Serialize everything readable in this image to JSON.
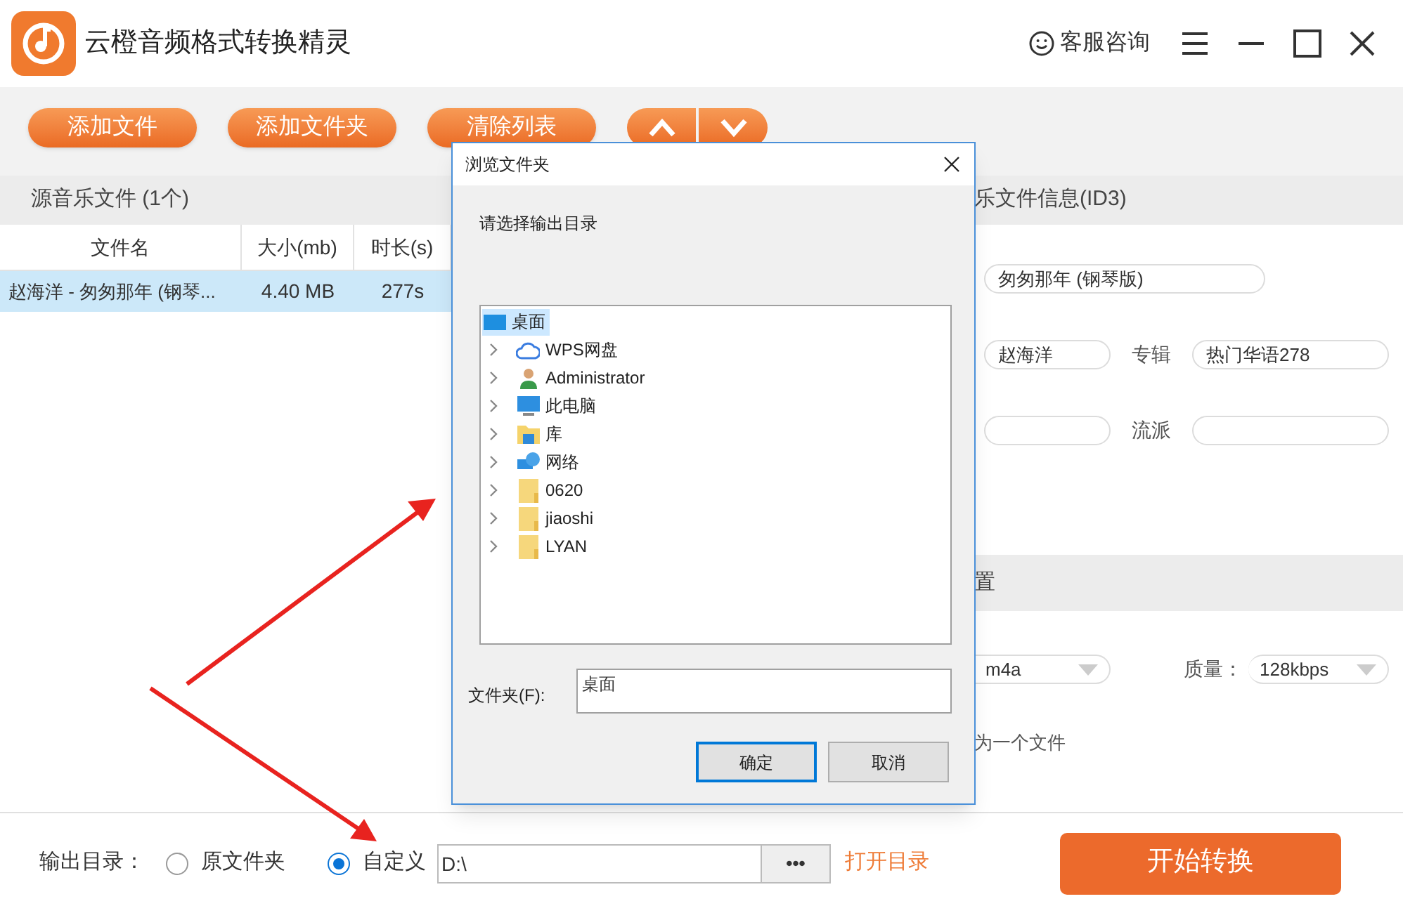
{
  "app": {
    "title": "云橙音频格式转换精灵",
    "support": "客服咨询"
  },
  "toolbar": {
    "buttons": [
      "添加文件",
      "添加文件夹",
      "清除列表"
    ]
  },
  "source_panel": {
    "title": "源音乐文件 (1个)",
    "columns": [
      "文件名",
      "大小(mb)",
      "时长(s)"
    ],
    "rows": [
      {
        "cells": [
          "赵海洋 - 匆匆那年 (钢琴...",
          "4.40 MB",
          "277s"
        ],
        "selected": true
      }
    ]
  },
  "id3_panel": {
    "title": "乐文件信息(ID3)",
    "rows": [
      {
        "items": [
          {
            "kind": "wide_field",
            "value": "匆匆那年 (钢琴版)"
          }
        ]
      },
      {
        "items": [
          {
            "kind": "short_field",
            "value": "赵海洋"
          },
          {
            "kind": "label",
            "text": "专辑"
          },
          {
            "kind": "long_field",
            "value": "热门华语278"
          }
        ]
      },
      {
        "items": [
          {
            "kind": "short_field"
          },
          {
            "kind": "label",
            "text": "流派"
          },
          {
            "kind": "long_field"
          }
        ]
      }
    ]
  },
  "settings_panel": {
    "title": "置",
    "format": "m4a",
    "quality_label": "质量：",
    "quality": "128kbps",
    "merge_text": "为一个文件"
  },
  "output": {
    "label": "输出目录：",
    "options": [
      {
        "label": "原文件夹",
        "selected": false
      },
      {
        "label": "自定义",
        "selected": true
      }
    ],
    "path": "D:\\",
    "browse": "•••",
    "open": "打开目录",
    "start": "开始转换"
  },
  "dialog": {
    "title": "浏览文件夹",
    "prompt": "请选择输出目录",
    "tree": [
      {
        "label": "桌面",
        "kind": "desktop",
        "selected": true,
        "children": [
          {
            "label": "WPS网盘",
            "kind": "cloud",
            "selected": false,
            "expanded": false
          },
          {
            "label": "Administrator",
            "kind": "user",
            "selected": false,
            "expanded": false
          },
          {
            "label": "此电脑",
            "kind": "computer",
            "selected": false,
            "expanded": false
          },
          {
            "label": "库",
            "kind": "library",
            "selected": false,
            "expanded": false
          },
          {
            "label": "网络",
            "kind": "network",
            "selected": false,
            "expanded": false
          },
          {
            "label": "0620",
            "kind": "folder",
            "selected": false,
            "expanded": false
          },
          {
            "label": "jiaoshi",
            "kind": "folder",
            "selected": false,
            "expanded": false
          },
          {
            "label": "LYAN",
            "kind": "folder",
            "selected": false,
            "expanded": false
          }
        ]
      }
    ],
    "folder_label": "文件夹(F):",
    "folder_value": "桌面",
    "buttons": [
      {
        "label": "确定",
        "default": true
      },
      {
        "label": "取消",
        "default": false
      }
    ]
  }
}
